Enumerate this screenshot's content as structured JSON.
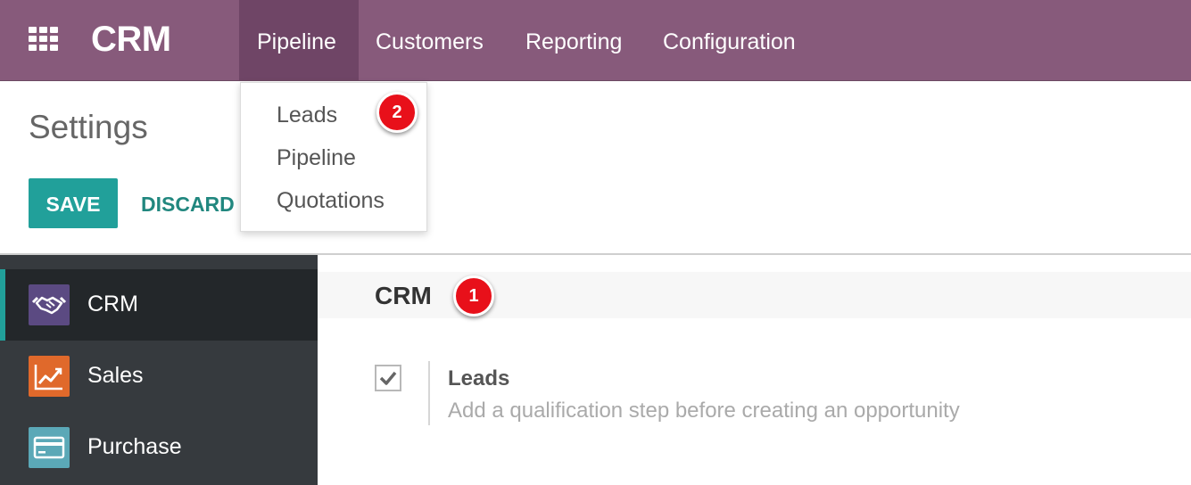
{
  "navbar": {
    "app_name": "CRM",
    "menus": [
      "Pipeline",
      "Customers",
      "Reporting",
      "Configuration"
    ],
    "active_menu": "Pipeline"
  },
  "dropdown": {
    "items": [
      "Leads",
      "Pipeline",
      "Quotations"
    ]
  },
  "control_panel": {
    "title": "Settings",
    "save_label": "SAVE",
    "discard_label": "DISCARD"
  },
  "sidebar": {
    "items": [
      {
        "label": "CRM",
        "icon": "handshake-icon",
        "color": "#5b4a82"
      },
      {
        "label": "Sales",
        "icon": "trend-chart-icon",
        "color": "#e0692b"
      },
      {
        "label": "Purchase",
        "icon": "credit-card-icon",
        "color": "#5ba8b7"
      }
    ],
    "active_index": 0
  },
  "main": {
    "section_title": "CRM",
    "option": {
      "title": "Leads",
      "description": "Add a qualification step before creating an opportunity",
      "checked": true
    }
  },
  "annotations": {
    "badge_1": "1",
    "badge_2": "2"
  },
  "colors": {
    "navbar": "#875a7b",
    "accent": "#21a09a",
    "badge": "#e8101a"
  }
}
